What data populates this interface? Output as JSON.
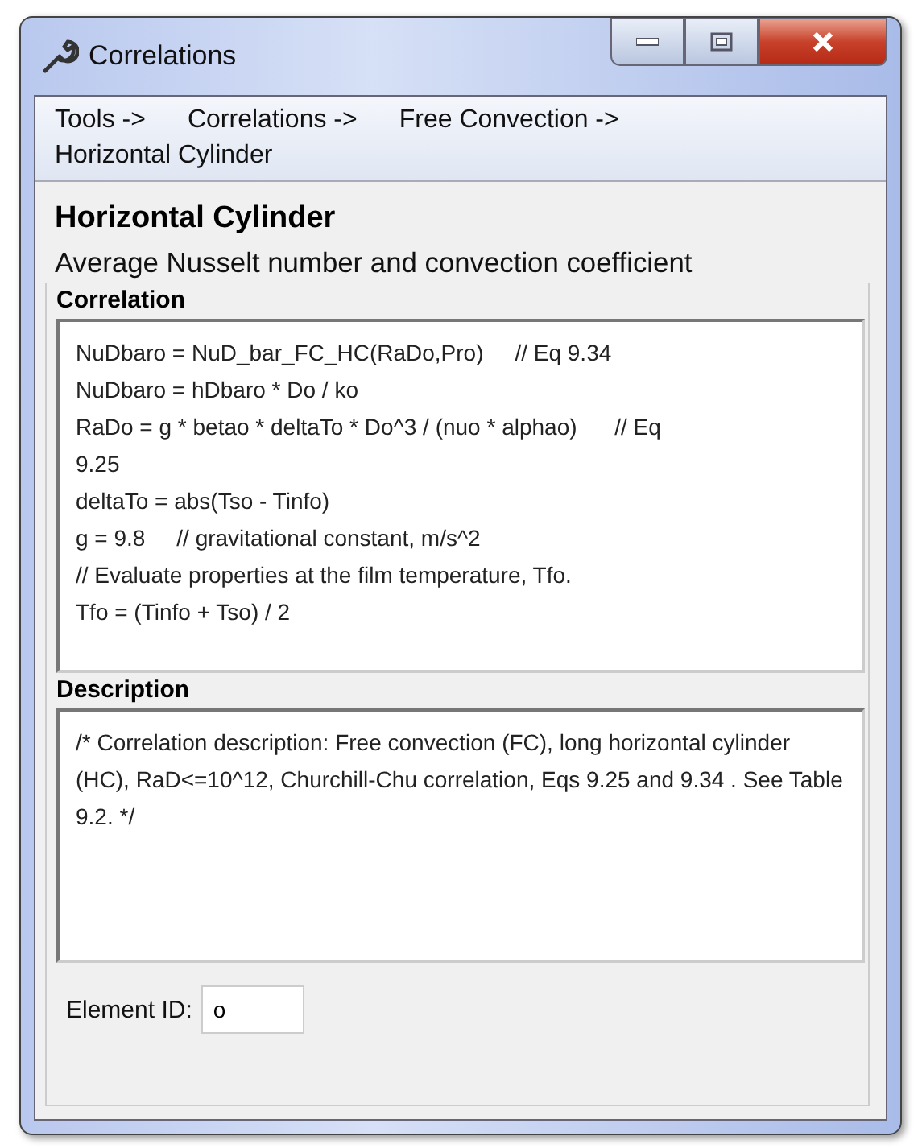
{
  "window": {
    "title": "Correlations"
  },
  "breadcrumb": [
    "Tools ->",
    "Correlations ->",
    "Free Convection ->",
    "Horizontal Cylinder"
  ],
  "heading": "Horizontal Cylinder",
  "subtitle": "Average Nusselt number and convection coefficient",
  "correlation": {
    "label": "Correlation",
    "lines": [
      "NuDbaro = NuD_bar_FC_HC(RaDo,Pro)     // Eq 9.34",
      "NuDbaro = hDbaro * Do / ko",
      "RaDo = g * betao * deltaTo * Do^3 / (nuo * alphao)      // Eq",
      "9.25",
      "deltaTo = abs(Tso - Tinfo)",
      "g = 9.8     // gravitational constant, m/s^2",
      "// Evaluate properties at the film temperature, Tfo.",
      "Tfo = (Tinfo + Tso) / 2"
    ]
  },
  "description": {
    "label": "Description",
    "text": "/* Correlation description: Free convection (FC), long horizontal cylinder (HC), RaD<=10^12, Churchill-Chu correlation, Eqs 9.25 and 9.34 . See Table 9.2. */"
  },
  "element_id": {
    "label": "Element ID:",
    "value": "o"
  }
}
